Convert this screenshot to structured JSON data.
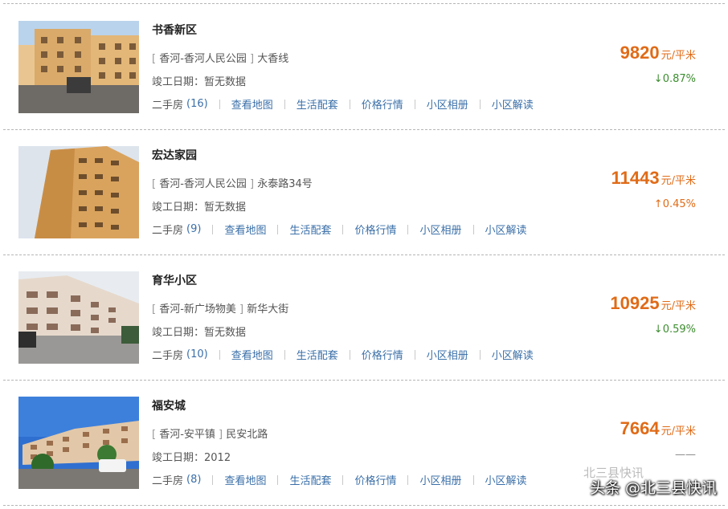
{
  "listings": [
    {
      "name": "书香新区",
      "location": "香河-香河人民公园",
      "street": "大香线",
      "completion_label": "竣工日期：",
      "completion_value": "暂无数据",
      "secondhand_label": "二手房",
      "secondhand_count": "(16)",
      "links": [
        "查看地图",
        "生活配套",
        "价格行情",
        "小区相册",
        "小区解读"
      ],
      "price": "9820",
      "price_unit": "元/平米",
      "change": "↓0.87%",
      "change_dir": "down"
    },
    {
      "name": "宏达家园",
      "location": "香河-香河人民公园",
      "street": "永泰路34号",
      "completion_label": "竣工日期：",
      "completion_value": "暂无数据",
      "secondhand_label": "二手房",
      "secondhand_count": "(9)",
      "links": [
        "查看地图",
        "生活配套",
        "价格行情",
        "小区相册",
        "小区解读"
      ],
      "price": "11443",
      "price_unit": "元/平米",
      "change": "↑0.45%",
      "change_dir": "up"
    },
    {
      "name": "育华小区",
      "location": "香河-新广场物美",
      "street": "新华大街",
      "completion_label": "竣工日期：",
      "completion_value": "暂无数据",
      "secondhand_label": "二手房",
      "secondhand_count": "(10)",
      "links": [
        "查看地图",
        "生活配套",
        "价格行情",
        "小区相册",
        "小区解读"
      ],
      "price": "10925",
      "price_unit": "元/平米",
      "change": "↓0.59%",
      "change_dir": "down"
    },
    {
      "name": "福安城",
      "location": "香河-安平镇",
      "street": "民安北路",
      "completion_label": "竣工日期：",
      "completion_value": "2012",
      "secondhand_label": "二手房",
      "secondhand_count": "(8)",
      "links": [
        "查看地图",
        "生活配套",
        "价格行情",
        "小区相册",
        "小区解读"
      ],
      "price": "7664",
      "price_unit": "元/平米",
      "change": "——",
      "change_dir": "none"
    }
  ],
  "watermark": {
    "main": "头条 @北三县快讯",
    "faint": "北三县快讯"
  },
  "colors": {
    "price": "#e06b17",
    "link": "#3a6fa8",
    "down": "#3c8d2f",
    "up": "#e06b17"
  }
}
